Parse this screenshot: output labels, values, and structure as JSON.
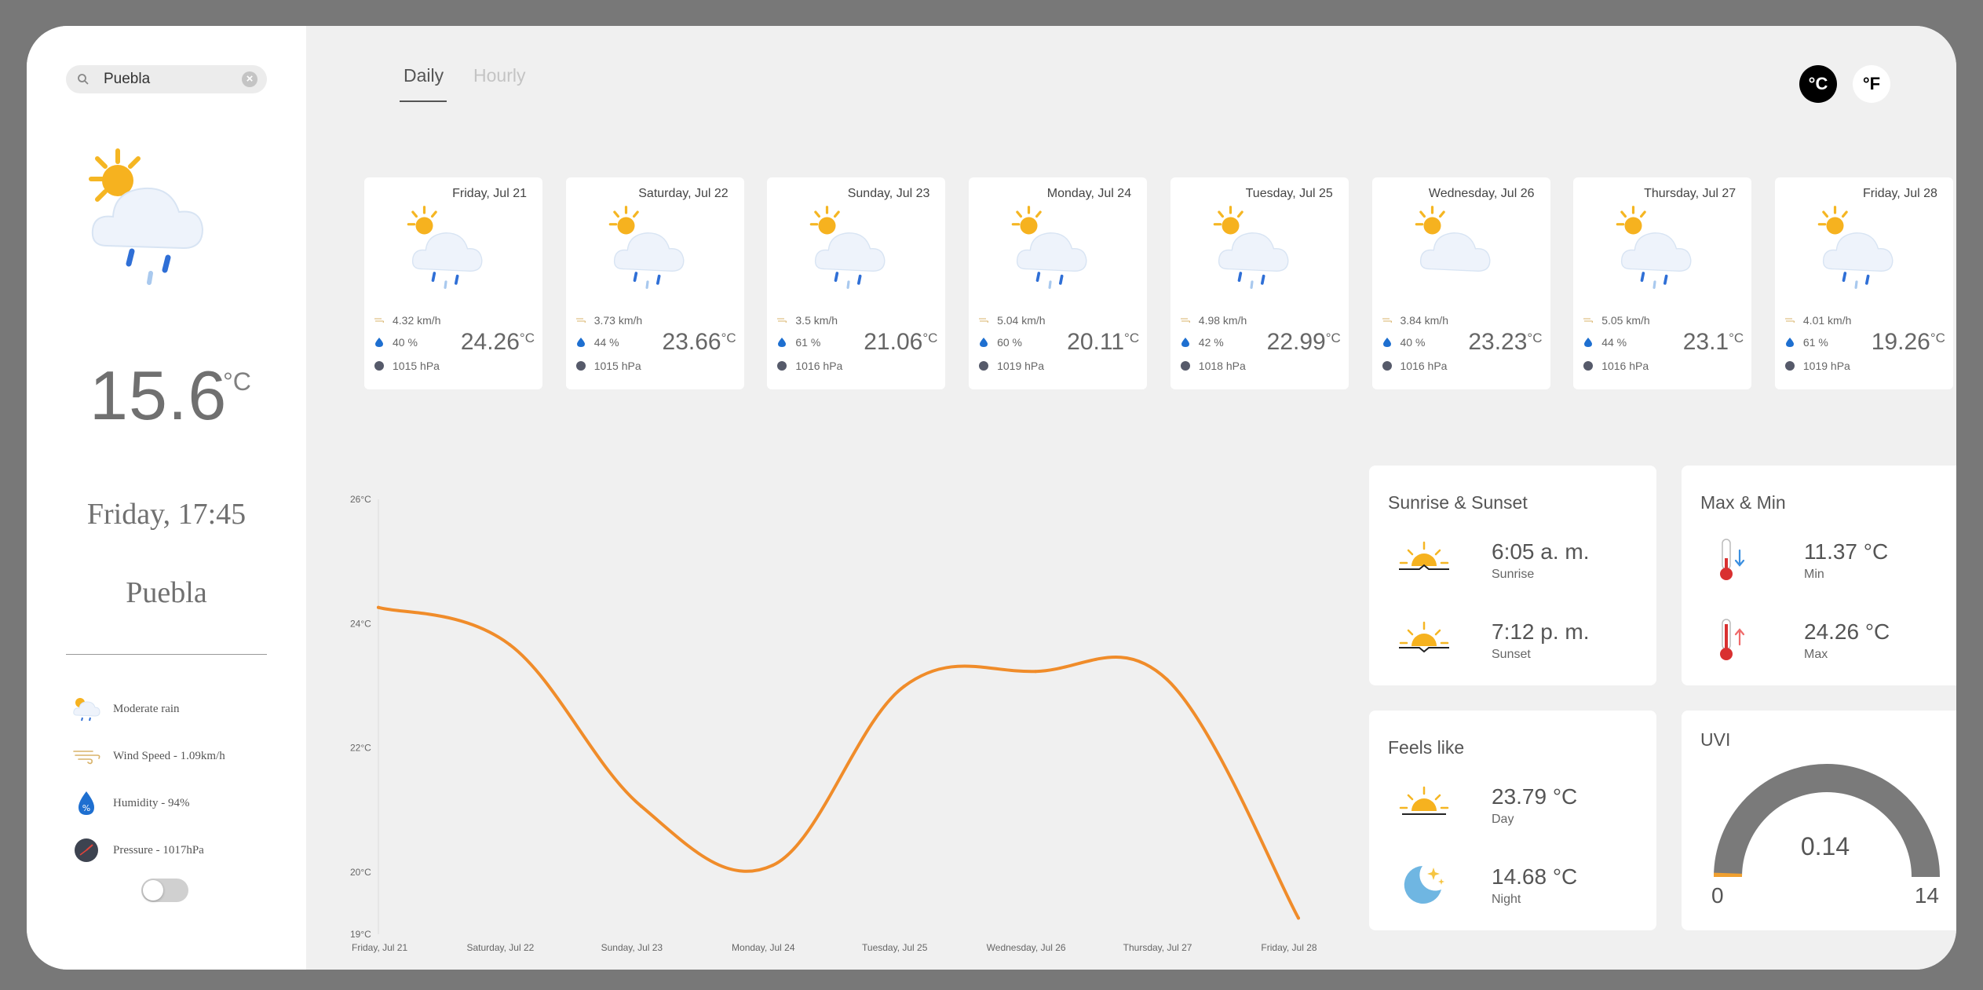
{
  "search": {
    "value": "Puebla",
    "clear_icon": "clear-icon"
  },
  "current": {
    "temp": "15.6",
    "unit": "°C",
    "datetime": "Friday, 17:45",
    "city": "Puebla",
    "icon": "sun-cloud-rain-icon",
    "details": [
      {
        "icon": "sun-cloud-rain-icon",
        "text": "Moderate rain"
      },
      {
        "icon": "wind-icon",
        "text": "Wind Speed  -  1.09km/h"
      },
      {
        "icon": "humidity-drop-icon",
        "text": "Humidity  -  94%"
      },
      {
        "icon": "pressure-gauge-icon",
        "text": "Pressure  -  1017hPa"
      }
    ]
  },
  "tabs": {
    "daily": "Daily",
    "hourly": "Hourly"
  },
  "units": {
    "celsius": "°C",
    "fahrenheit": "°F"
  },
  "days": [
    {
      "date": "Friday, Jul 21",
      "wind": "4.32 km/h",
      "humidity": "40 %",
      "pressure": "1015 hPa",
      "temp": "24.26",
      "unit": "°C",
      "icon": "sun-cloud-rain-icon"
    },
    {
      "date": "Saturday, Jul 22",
      "wind": "3.73 km/h",
      "humidity": "44 %",
      "pressure": "1015 hPa",
      "temp": "23.66",
      "unit": "°C",
      "icon": "sun-cloud-rain-icon"
    },
    {
      "date": "Sunday, Jul 23",
      "wind": "3.5 km/h",
      "humidity": "61 %",
      "pressure": "1016 hPa",
      "temp": "21.06",
      "unit": "°C",
      "icon": "sun-cloud-rain-icon"
    },
    {
      "date": "Monday, Jul 24",
      "wind": "5.04 km/h",
      "humidity": "60 %",
      "pressure": "1019 hPa",
      "temp": "20.11",
      "unit": "°C",
      "icon": "sun-cloud-rain-icon"
    },
    {
      "date": "Tuesday, Jul 25",
      "wind": "4.98 km/h",
      "humidity": "42 %",
      "pressure": "1018 hPa",
      "temp": "22.99",
      "unit": "°C",
      "icon": "sun-cloud-rain-icon"
    },
    {
      "date": "Wednesday, Jul 26",
      "wind": "3.84 km/h",
      "humidity": "40 %",
      "pressure": "1016 hPa",
      "temp": "23.23",
      "unit": "°C",
      "icon": "sun-cloud-icon"
    },
    {
      "date": "Thursday, Jul 27",
      "wind": "5.05 km/h",
      "humidity": "44 %",
      "pressure": "1016 hPa",
      "temp": "23.1",
      "unit": "°C",
      "icon": "sun-cloud-rain-icon"
    },
    {
      "date": "Friday, Jul 28",
      "wind": "4.01 km/h",
      "humidity": "61 %",
      "pressure": "1019 hPa",
      "temp": "19.26",
      "unit": "°C",
      "icon": "sun-cloud-rain-icon"
    }
  ],
  "chart_data": {
    "type": "line",
    "categories": [
      "Friday, Jul 21",
      "Saturday, Jul 22",
      "Sunday, Jul 23",
      "Monday, Jul 24",
      "Tuesday, Jul 25",
      "Wednesday, Jul 26",
      "Thursday, Jul 27",
      "Friday, Jul 28"
    ],
    "series": [
      {
        "values": [
          24.26,
          23.66,
          21.06,
          20.11,
          22.99,
          23.23,
          23.1,
          19.26
        ],
        "color": "#f08c2a"
      }
    ],
    "yticks": [
      "26°C",
      "24°C",
      "22°C",
      "20°C",
      "19°C"
    ],
    "ylim": [
      19,
      26
    ],
    "grid": false,
    "title": "",
    "xlabel": "",
    "ylabel": ""
  },
  "sun": {
    "title": "Sunrise & Sunset",
    "sunrise": "6:05 a. m.",
    "sunrise_label": "Sunrise",
    "sunset": "7:12 p. m.",
    "sunset_label": "Sunset"
  },
  "maxmin": {
    "title": "Max & Min",
    "min": "11.37 °C",
    "min_label": "Min",
    "max": "24.26 °C",
    "max_label": "Max"
  },
  "feels": {
    "title": "Feels like",
    "day": "23.79 °C",
    "day_label": "Day",
    "night": "14.68 °C",
    "night_label": "Night"
  },
  "uvi": {
    "title": "UVI",
    "value": "0.14",
    "min": "0",
    "max": "14",
    "fraction": 0.01,
    "gauge_color": "#7a7a7a",
    "fill_color": "#f0a030"
  }
}
